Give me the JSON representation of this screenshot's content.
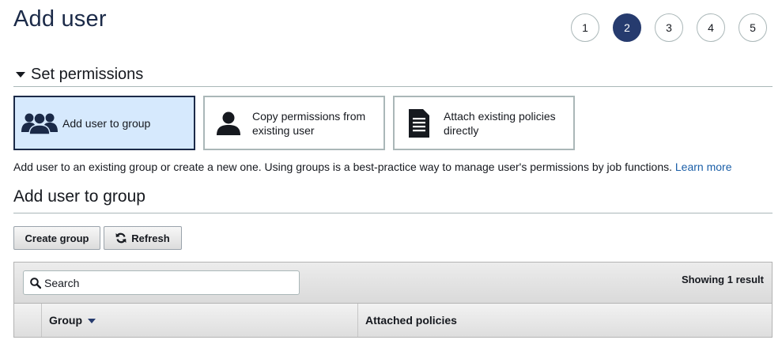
{
  "page": {
    "title": "Add user"
  },
  "steps": [
    "1",
    "2",
    "3",
    "4",
    "5"
  ],
  "active_step": "2",
  "permissions": {
    "section_title": "Set permissions",
    "options": [
      {
        "label": "Add user to group",
        "icon": "user-group-icon",
        "selected": true
      },
      {
        "label": "Copy permissions from existing user",
        "icon": "user-icon",
        "selected": false
      },
      {
        "label": "Attach existing policies directly",
        "icon": "document-icon",
        "selected": false
      }
    ],
    "description": "Add user to an existing group or create a new one. Using groups is a best-practice way to manage user's permissions by job functions.",
    "learn_more": "Learn more"
  },
  "group_section": {
    "title": "Add user to group",
    "create_button": "Create group",
    "refresh_button": "Refresh",
    "refresh_icon": "refresh-icon",
    "search_placeholder": "Search",
    "search_icon": "search-icon",
    "showing_prefix": "Showing",
    "result_count": "1",
    "result_suffix": "result",
    "columns": [
      "Group",
      "Attached policies"
    ]
  },
  "colors": {
    "accent": "#263b6e",
    "selected_bg": "#d6e9fd",
    "link": "#1b5fa8"
  }
}
